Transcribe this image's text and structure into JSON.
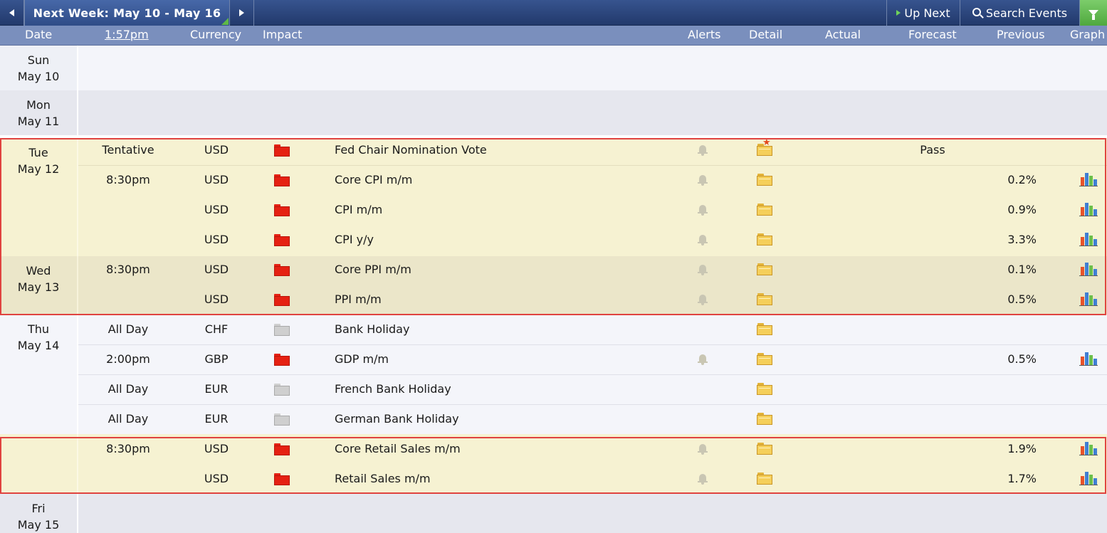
{
  "nav": {
    "prev_icon": "triangle-left-icon",
    "week_title": "Next Week: May 10 - May 16",
    "next_icon": "triangle-right-icon",
    "up_next_label": "Up Next",
    "up_next_icon": "play-icon",
    "search_label": "Search Events",
    "search_icon": "magnifier-icon",
    "filter_icon": "funnel-icon"
  },
  "columns": {
    "date": "Date",
    "time": "1:57pm",
    "currency": "Currency",
    "impact": "Impact",
    "alerts": "Alerts",
    "detail": "Detail",
    "actual": "Actual",
    "forecast": "Forecast",
    "previous": "Previous",
    "graph": "Graph"
  },
  "colors": {
    "high_impact": "#e52112",
    "non_economic": "#cfcfcf",
    "highlight_border": "#e0433f",
    "header_bar": "#7a8fbd",
    "top_bar": "#2a437a"
  },
  "days": [
    {
      "weekday": "Sun",
      "date": "May 10"
    },
    {
      "weekday": "Mon",
      "date": "May 11"
    },
    {
      "weekday": "Tue",
      "date": "May 12"
    },
    {
      "weekday": "Wed",
      "date": "May 13"
    },
    {
      "weekday": "Thu",
      "date": "May 14"
    },
    {
      "weekday": "Fri",
      "date": "May 15"
    }
  ],
  "events": [
    {
      "time": "Tentative",
      "currency": "USD",
      "impact": "high",
      "event": "Fed Chair Nomination Vote",
      "alert": true,
      "detail": "folder-star",
      "actual": "",
      "forecast": "Pass",
      "previous": "",
      "graph": false
    },
    {
      "time": "8:30pm",
      "currency": "USD",
      "impact": "high",
      "event": "Core CPI m/m",
      "alert": true,
      "detail": "folder",
      "actual": "",
      "forecast": "",
      "previous": "0.2%",
      "graph": true
    },
    {
      "time": "",
      "currency": "USD",
      "impact": "high",
      "event": "CPI m/m",
      "alert": true,
      "detail": "folder",
      "actual": "",
      "forecast": "",
      "previous": "0.9%",
      "graph": true
    },
    {
      "time": "",
      "currency": "USD",
      "impact": "high",
      "event": "CPI y/y",
      "alert": true,
      "detail": "folder",
      "actual": "",
      "forecast": "",
      "previous": "3.3%",
      "graph": true
    },
    {
      "time": "8:30pm",
      "currency": "USD",
      "impact": "high",
      "event": "Core PPI m/m",
      "alert": true,
      "detail": "folder",
      "actual": "",
      "forecast": "",
      "previous": "0.1%",
      "graph": true
    },
    {
      "time": "",
      "currency": "USD",
      "impact": "high",
      "event": "PPI m/m",
      "alert": true,
      "detail": "folder",
      "actual": "",
      "forecast": "",
      "previous": "0.5%",
      "graph": true
    },
    {
      "time": "All Day",
      "currency": "CHF",
      "impact": "non-economic",
      "event": "Bank Holiday",
      "alert": false,
      "detail": "folder",
      "actual": "",
      "forecast": "",
      "previous": "",
      "graph": false
    },
    {
      "time": "2:00pm",
      "currency": "GBP",
      "impact": "high",
      "event": "GDP m/m",
      "alert": true,
      "detail": "folder",
      "actual": "",
      "forecast": "",
      "previous": "0.5%",
      "graph": true
    },
    {
      "time": "All Day",
      "currency": "EUR",
      "impact": "non-economic",
      "event": "French Bank Holiday",
      "alert": false,
      "detail": "folder",
      "actual": "",
      "forecast": "",
      "previous": "",
      "graph": false
    },
    {
      "time": "All Day",
      "currency": "EUR",
      "impact": "non-economic",
      "event": "German Bank Holiday",
      "alert": false,
      "detail": "folder",
      "actual": "",
      "forecast": "",
      "previous": "",
      "graph": false
    },
    {
      "time": "8:30pm",
      "currency": "USD",
      "impact": "high",
      "event": "Core Retail Sales m/m",
      "alert": true,
      "detail": "folder",
      "actual": "",
      "forecast": "",
      "previous": "1.9%",
      "graph": true
    },
    {
      "time": "",
      "currency": "USD",
      "impact": "high",
      "event": "Retail Sales m/m",
      "alert": true,
      "detail": "folder",
      "actual": "",
      "forecast": "",
      "previous": "1.7%",
      "graph": true
    }
  ]
}
